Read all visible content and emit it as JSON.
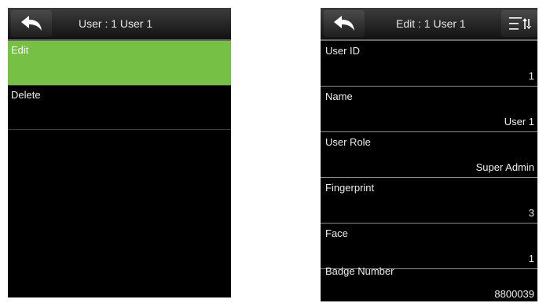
{
  "left_screen": {
    "title": "User : 1 User 1",
    "items": [
      {
        "label": "Edit"
      },
      {
        "label": "Delete"
      }
    ]
  },
  "right_screen": {
    "title": "Edit : 1 User 1",
    "fields": [
      {
        "label": "User ID",
        "value": "1"
      },
      {
        "label": "Name",
        "value": "User 1"
      },
      {
        "label": "User Role",
        "value": "Super Admin"
      },
      {
        "label": "Fingerprint",
        "value": "3"
      },
      {
        "label": "Face",
        "value": "1"
      },
      {
        "label": "Badge Number",
        "value": "8800039"
      }
    ]
  },
  "colors": {
    "selected": "#77c046",
    "background": "#000000"
  },
  "icons": {
    "back": "back-arrow-icon",
    "menu": "sort-menu-icon"
  }
}
